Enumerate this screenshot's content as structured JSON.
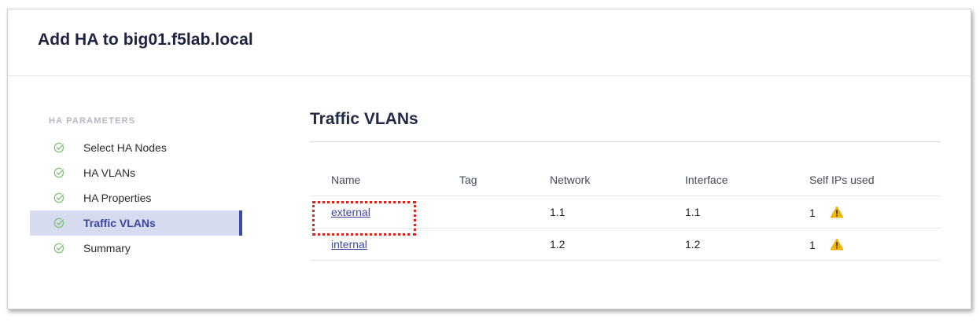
{
  "dialog": {
    "title": "Add HA to big01.f5lab.local"
  },
  "sidebar": {
    "section_label": "HA PARAMETERS",
    "steps": [
      {
        "label": "Select HA Nodes",
        "status": "complete"
      },
      {
        "label": "HA VLANs",
        "status": "complete"
      },
      {
        "label": "HA Properties",
        "status": "complete"
      },
      {
        "label": "Traffic VLANs",
        "status": "complete",
        "active": true
      },
      {
        "label": "Summary",
        "status": "complete"
      }
    ]
  },
  "content": {
    "title": "Traffic VLANs",
    "table": {
      "headers": [
        "Name",
        "Tag",
        "Network",
        "Interface",
        "Self IPs used"
      ],
      "rows": [
        {
          "name": "external",
          "tag": "",
          "network": "1.1",
          "interface": "1.1",
          "self_ips": "1",
          "warning": true,
          "highlighted": true
        },
        {
          "name": "internal",
          "tag": "",
          "network": "1.2",
          "interface": "1.2",
          "self_ips": "1",
          "warning": true,
          "highlighted": false
        }
      ]
    }
  },
  "colors": {
    "title": "#1d2340",
    "accent": "#3b4aa8",
    "active_bg": "#d7dbef",
    "check": "#7cc36f",
    "warning": "#f2b705",
    "highlight": "#d9261c"
  },
  "icons": {
    "step_status": "check-circle-icon",
    "row_warning": "warning-triangle-icon"
  }
}
